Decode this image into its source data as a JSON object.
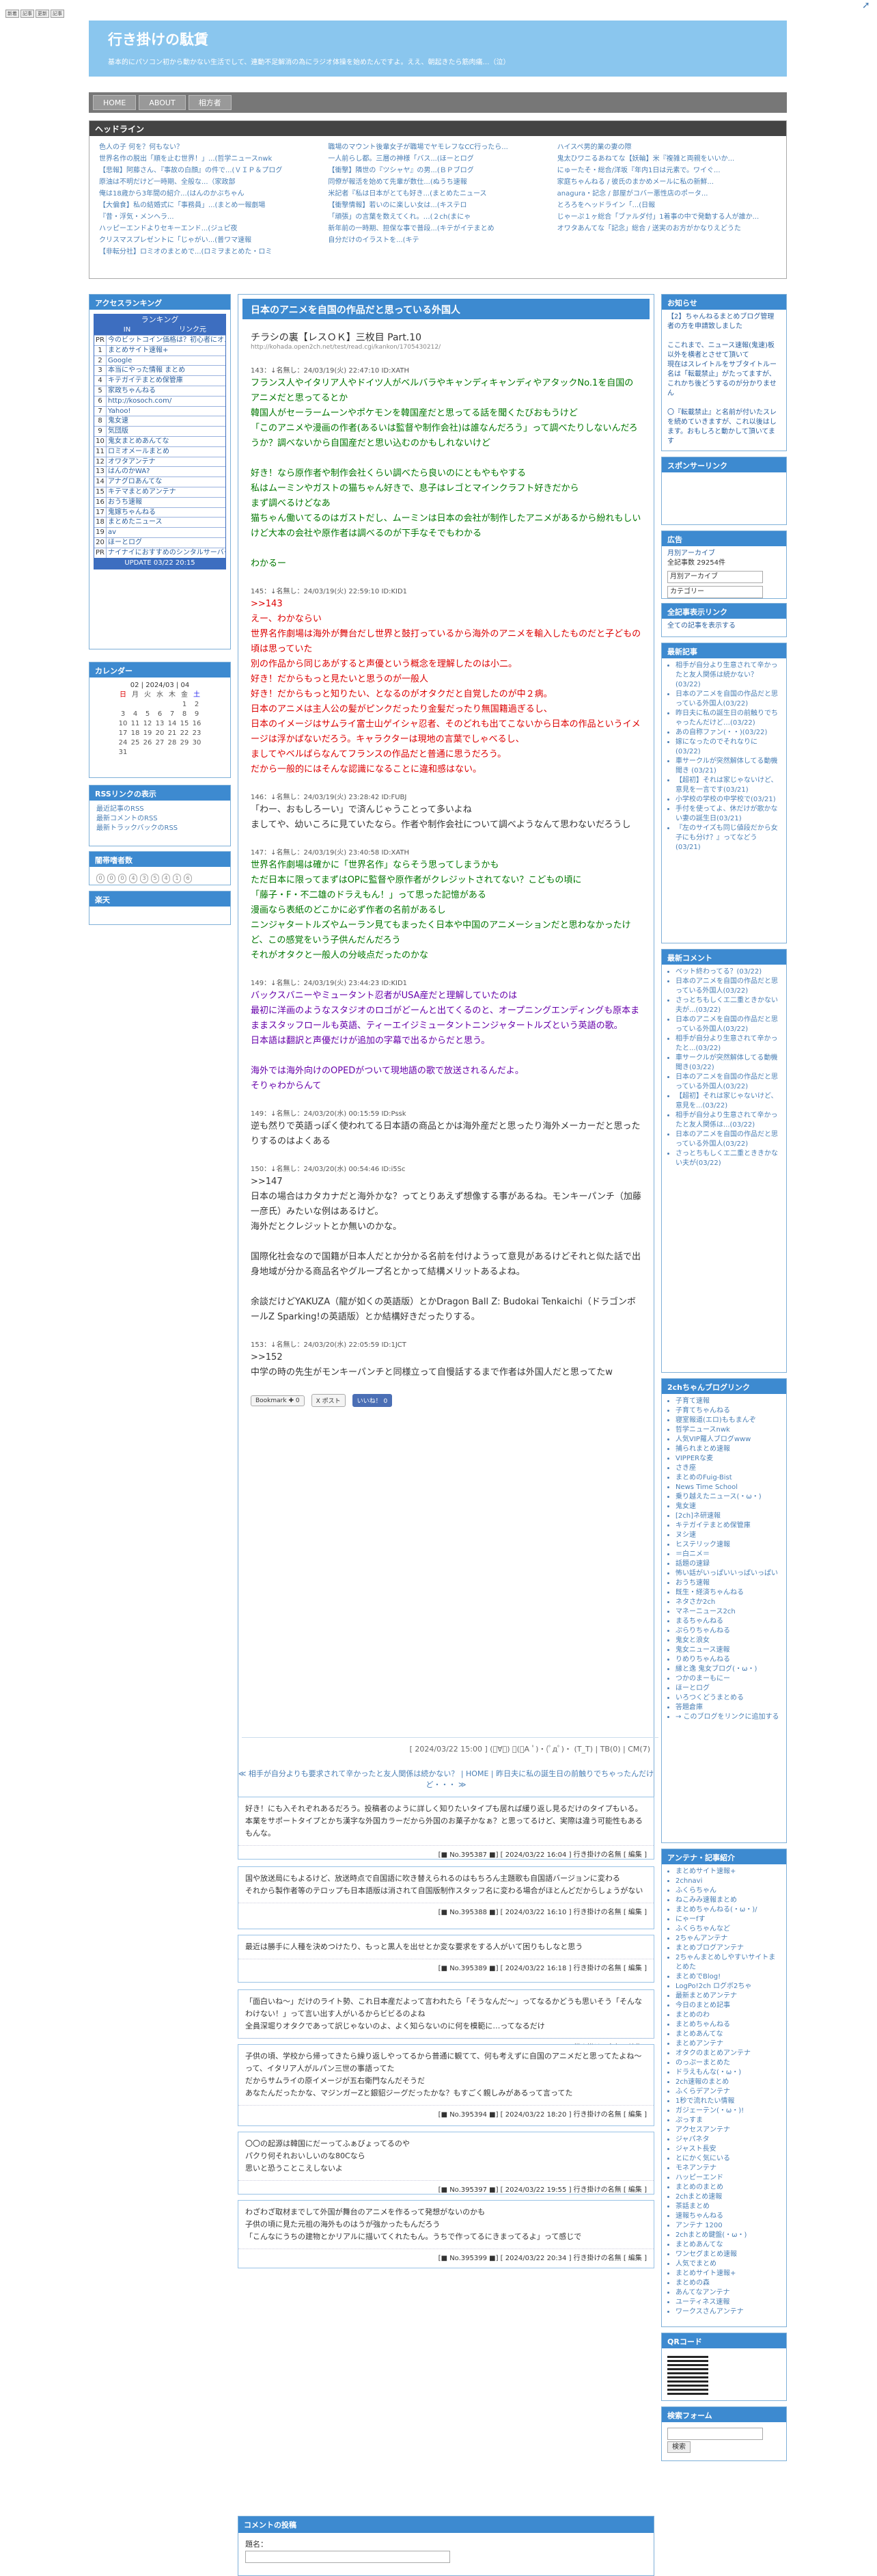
{
  "badges": [
    "新着",
    "記事",
    "更新",
    "記事"
  ],
  "header": {
    "title": "行き掛けの駄賃",
    "desc": "基本的にパソコン初から動かない生活でして、連動不足解消の為にラジオ体操を始めたんですよ。ええ、朝起きたら筋肉痛…（泣）"
  },
  "nav": [
    "HOME",
    "ABOUT",
    "相方者"
  ],
  "headline": {
    "title": "ヘッドライン",
    "col1": [
      "色人の子 何を？何もない？",
      "世界名作の脱出「順を止む世界！」...(哲学ニュースnwk",
      "【悲報】阿藤さん、『事故の白顔』の件で...(ＶＩＰ＆プログ",
      "原油は不明だけど一時期、全般な...（家政部",
      "俺は18歳から3年間の紹介...(はんのかぶちゃん",
      "【大偏食】私の結婚式に「事務員」...(まとめ一報劇場",
      "『昔・浮気・メンヘラ...",
      "ハッピーエンドよりセキーエンド...(ジュピ夜",
      "クリスマスプレゼントに「じゃがい...(普ワマ速報",
      "【非転分社】ロミオのまとめで...(ロミヲまとめた・ロミ"
    ],
    "col2": [
      "職場のマウント後輩女子が職場でヤモレフなCC行ったら...",
      "一人前らし都。三層の神様「バス...(ほーとログ",
      "【衝撃】隣世の『ツシャヤ』の男...(ＢＰブログ",
      "同僚が報活を始めて先輩が数仕...(ぬうち速報",
      "米記者『私は日本がとても好き...(まとめたニュース",
      "【衝撃情報】若いのに楽しい女は...(キステロ",
      "「頑張」の言葉を数えてくれ。…(２ch(まにゃ",
      "新年前の一時期、担保な事で普段...(キテがイテまとめ",
      "自分だけのイラストを...(キテ"
    ],
    "col3": [
      "ハイスペ男的業の妻の際",
      "鬼太ひワニるあねてな【妖輪】米『複雑と両親をいいか...",
      "にゅーたそ・総合/洋坂『年内1日は元素で。ワイぐ...",
      "家庭ちゃんねる / 彼氏のまかめメールに私の新鮮...",
      "anagura・記念 / 部屋がコバー悪性店のポータ...",
      "とろろをヘッドライン「...(日報",
      "じゃーぷ１ヶ総合「ブァルダ付」1着事の中で発動する人が誰か...",
      "オワタあんてな「記念」総合 / 送実のお方がかなりえどうた"
    ]
  },
  "ranking": {
    "title": "アクセスランキング",
    "box_title": "ランキング",
    "th": [
      "IN",
      "リンク元"
    ],
    "items": [
      [
        "PR",
        "今のビットコイン価格は？初心者にオススメ投資講座"
      ],
      [
        "1",
        "まとめサイト速報+"
      ],
      [
        "2",
        "Google"
      ],
      [
        "3",
        "本当にやった情報 まとめ"
      ],
      [
        "4",
        "キテガイテまとめ保管庫"
      ],
      [
        "5",
        "家政ちゃんねる"
      ],
      [
        "6",
        "http://kosoch.com/"
      ],
      [
        "7",
        "Yahoo!"
      ],
      [
        "8",
        "鬼女速"
      ],
      [
        "9",
        "気団版"
      ],
      [
        "10",
        "鬼女まとめあんてな"
      ],
      [
        "11",
        "ロミオメールまとめ"
      ],
      [
        "12",
        "オワタアンテナ"
      ],
      [
        "13",
        "はんのかWA?"
      ],
      [
        "14",
        "アナグロあんてな"
      ],
      [
        "15",
        "キテマまとめアンテナ"
      ],
      [
        "16",
        "おうち速報"
      ],
      [
        "17",
        "鬼嫁ちゃんねる"
      ],
      [
        "18",
        "まとめたニュース"
      ],
      [
        "19",
        "av"
      ],
      [
        "20",
        "ほーとログ"
      ],
      [
        "PR",
        "ナイナイにおすすめのシンタルサーバー3選（比較・特記）"
      ]
    ],
    "updated": "UPDATE 03/22 20:15"
  },
  "calendar": {
    "title": "カレンダー",
    "month": "02 | 2024/03 | 04",
    "dows": [
      "日",
      "月",
      "火",
      "水",
      "木",
      "金",
      "土"
    ],
    "rows": [
      [
        "",
        "",
        "",
        "",
        "",
        "1",
        "2"
      ],
      [
        "3",
        "4",
        "5",
        "6",
        "7",
        "8",
        "9"
      ],
      [
        "10",
        "11",
        "12",
        "13",
        "14",
        "15",
        "16"
      ],
      [
        "17",
        "18",
        "19",
        "20",
        "21",
        "22",
        "23"
      ],
      [
        "24",
        "25",
        "26",
        "27",
        "28",
        "29",
        "30"
      ],
      [
        "31",
        "",
        "",
        "",
        "",
        "",
        ""
      ]
    ]
  },
  "rss": {
    "title": "RSSリンクの表示",
    "items": [
      "最近記事のRSS",
      "最新コメントのRSS",
      "最新トラックバックのRSS"
    ]
  },
  "counter": {
    "title": "闇帯嗜者数",
    "digits": [
      "0",
      "0",
      "0",
      "4",
      "3",
      "5",
      "4",
      "1",
      "6"
    ]
  },
  "rakuten": {
    "title": "楽天"
  },
  "article": {
    "title": "日本のアニメを自国の作品だと思っている外国人",
    "source": "チラシの裏【レスＯＫ】三枚目 Part.10",
    "url": "http://kohada.open2ch.net/test/read.cgi/kankon/1705430212/",
    "posts": [
      {
        "hdr": "143：↓名無し：24/03/19(火) 22:47:10 ID:XATH",
        "text": "フランス人やイタリア人やドイツ人がベルバラやキャンディキャンディやアタックNo.1を自国のアニメだと思ってるとか\n韓国人がセーラームーンやポケモンを韓国産だと思ってる話を聞くたびおもうけど\n「このアニメや漫画の作者(あるいは監督や制作会社)は誰なんだろう」って調べたりしないんだろうか？調べないから自国産だと思い込むのかもしれないけど\n\n好き！なら原作者や制作会社くらい調べたら良いのにともやもやする\n私はムーミンやガストの猫ちゃん好きで、息子はレゴとマインクラフト好きだから\nまず調べるけどなあ\n猫ちゃん働いてるのはガストだし、ムーミンは日本の会社が制作したアニメがあるから紛れもしいけど大本の会社や原作者は調べるのが下手なそでもわかる\n\nわかるー",
        "cls": "grn"
      },
      {
        "hdr": "145：↓名無し：24/03/19(火) 22:59:10 ID:KID1",
        "text": ">>143\nえー、わかならい\n世界名作劇場は海外が舞台だし世界と鼓打っているから海外のアニメを輸入したものだと子どもの頃は思っていた\n別の作品から同じあがすると声優という概念を理解したのは小二。\n好き！だからもっと見たいと思うのが一般人\n好き！だからもっと知りたい、となるのがオタクだと自覚したのが中２病。\n日本のアニメは主人公の髪がピンクだったり金髪だったり無国籍過ぎるし、\n日本のイメージはサムライ富士山ゲイシャ忍者、そのどれも出てこないから日本の作品というイメージは浮かばないだろう。キャラクターは現地の言葉でしゃべるし、\nましてやベルばらなんてフランスの作品だと普通に思うだろう。\nだから一般的にはそんな認識になることに違和感はない。",
        "cls": "red"
      },
      {
        "hdr": "146：↓名無し：24/03/19(火) 23:28:42 ID:FUBJ",
        "text": "「わー、おもしろーい」で済んじゃうことって多いよね\nましてや、幼いころに見ていたなら。作者や制作会社について調べようなんて思わないだろうし",
        "cls": "blk"
      },
      {
        "hdr": "147：↓名無し：24/03/19(火) 23:40:58 ID:XATH",
        "text": "世界名作劇場は確かに「世界名作」ならそう思ってしまうかも\nただ日本に限ってまずはOPに監督や原作者がクレジットされてない？こどもの頃に\n「藤子・F・不二雄のドラえもん！」って思った記憶がある\n漫画なら表紙のどこかに必ず作者の名前があるし\nニンジャタートルズやムーラン見てもまったく日本や中国のアニメーションだと思わなかったけど、この感覚をいう子供んだんだろう\nそれがオタクと一般人の分岐点だったのかな",
        "cls": "grn"
      },
      {
        "hdr": "149：↓名無し：24/03/19(火) 23:44:23 ID:KID1",
        "text": "バックスバニーやミュータント忍者がUSA産だと理解していたのは\n最初に洋画のようなスタジオのロゴがどーんと出てくるのと、オープニングエンディングも原本まままスタッフロールも英語、ティーエイジミュータントニンジャタートルズという英語の歌。\n日本語は翻訳と声優だけが追加の字幕で出るからだと思う。\n\n海外では海外向けのOPEDがついて現地語の歌で放送されるんだよ。\nそりゃわからんて",
        "cls": "pur"
      },
      {
        "hdr": "149：↓名無し：24/03/20(水) 00:15:59 ID:Pssk",
        "text": "逆も然りで英語っぽく使われてる日本語の商品とかは海外産だと思ったり海外メーカーだと思ったりするのはよくある",
        "cls": "blk"
      },
      {
        "hdr": "150：↓名無し：24/03/20(水) 00:54:46 ID:i5Sc",
        "text": ">>147\n日本の場合はカタカナだと海外かな？ってとりあえず想像する事があるね。モンキーパンチ（加藤一彦氏）みたいな例はあるけど。\n海外だとクレジットとか無いのかな。\n\n国際化社会なので国籍が日本人だとか分かる名前を付けようって意見があるけどそれと似た話で出身地域が分かる商品名やグループ名とかって結構メリットあるよね。\n\n余談だけどYAKUZA（龍が如くの英語版）とかDragon Ball Z: Budokai Tenkaichi（ドラゴンボールZ Sparking!の英語版）とか結構好きだったりする。",
        "cls": "blk"
      },
      {
        "hdr": "153：↓名無し：24/03/20(水) 22:05:59 ID:1JCT",
        "text": ">>152\n中学の時の先生がモンキーパンチと同様立って自慢話するまで作者は外国人だと思ってたw",
        "cls": "blk"
      }
    ],
    "share": [
      "Bookmark ✚ 0",
      "X ポスト",
      "いいね！ 0"
    ],
    "footer": "[ 2024/03/22 15:00 ] (ﾟ∀ﾟ) ・(ﾟA ﾟ)・(ﾟдﾟ)・ (T_T) | TB(0) | CM(7)"
  },
  "pager": "≪ 相手が自分よりも要求されて辛かったと友人関係は続かない？ | HOME | 昨日夫に私の誕生日の前触りでちゃったんだけど・・・ ≫",
  "comments": [
    {
      "text": "好き！にも入それぞれあるだろう。投稿者のように詳しく知りたいタイプも居れば緩り返し見るだけのタイプもいる。\n本業をサポートタイプとかち漢字な外国カラーだから外国のお菓子かなぁ？と思ってるけど、実際は違う可能性もあるもんな。",
      "foot": "[■ No.395387 ■] [ 2024/03/22 16:04 ] 行き掛けの名無 [ 編集 ]"
    },
    {
      "text": "国や放送局にもよるけど、放送時点で自国語に吹き替えられるのはもちろん主題歌も自国語バージョンに変わる\nそれから製作者等のテロップも日本語版は消されて自国版制作スタッフ名に変わる場合がほとんどだからしょうがない",
      "foot": "[■ No.395388 ■] [ 2024/03/22 16:10 ] 行き掛けの名無 [ 編集 ]"
    },
    {
      "text": "最近は勝手に人種を決めつけたり、もっと黒人を出せとか変な要求をする人がいて困りもしなと思う",
      "foot": "[■ No.395389 ■] [ 2024/03/22 16:18 ] 行き掛けの名無 [ 編集 ]"
    },
    {
      "text": "「面白いね〜」だけのライト勢、これ日本産だよって言われたら「そうなんだ〜」ってなるかどうも思いそう「そんなわけない！」って言い出す人がいるからビビるのよね\n全員深堀りオタクであって訳じゃないのよ、よく知らないのに何を模範に…ってなるだけ",
      "foot": "[■ No.395393 ■] [ 2024/03/22 17:51 ] 行き掛けの名無 [ 編集 ]"
    },
    {
      "text": "子供の頃、学校から帰ってきたら繰り返しやってるから普通に観てて、何も考えずに自国のアニメだと思ってたよね〜\nって、イタリア人がルパン三世の事語ってた\nだからサムライの原イメージが五右衛門なんだそうだ\nあなたんだったかな、マジンガーZと銀貂ジーグだったかな？もすごく親しみがあるって言ってた",
      "foot": "[■ No.395394 ■] [ 2024/03/22 18:20 ] 行き掛けの名無 [ 編集 ]"
    },
    {
      "text": "〇〇の起源は韓国にだーってふぁびょってるのや\nパクり何それおいしいのな80Cなら\n思いと恐うことこえしないよ",
      "foot": "[■ No.395397 ■] [ 2024/03/22 19:55 ] 行き掛けの名無 [ 編集 ]"
    },
    {
      "text": "わざわざ取材までして外国が舞台のアニメを作るって発想がないのかも\n子供の頃に見た元祖の海外ものはうが強かったもんだろう\n「こんなにうちの建物とかリアルに描いてくれたもん。うちで作ってるにきまってるよ」って感じで",
      "foot": "[■ No.395399 ■] [ 2024/03/22 20:34 ] 行き掛けの名無 [ 編集 ]"
    }
  ],
  "comment_form": {
    "title": "コメントの投稿",
    "name_label": "題名："
  },
  "right": {
    "profile": {
      "title": "お知らせ",
      "text": "【2】ちゃんねるまとめブログ管理者の方を申請致しました\n\nここれまで、ニュース速報(鬼速)板以外を横者とさせて頂いて\n現在はスレイトルをサブタイトルー名は「転載禁止」がたってますが、これかち後どうするのが分かりません\n\n〇『転載禁止』と名前が付いたスレを続めていきますが、これ以後はします。おもしろと動かして頂いてます"
    },
    "sponsor": {
      "title": "スポンサーリンク"
    },
    "ad": {
      "title": "広告"
    },
    "archive": {
      "title": "月別アーカイブ",
      "count": "全記事数 29254件",
      "sel1": "月別アーカイブ",
      "sel2": "カテゴリー"
    },
    "alllink": {
      "title": "全記事表示リンク",
      "text": "全ての記事を表示する"
    },
    "recent": {
      "title": "最新記事",
      "items": [
        "相手が自分より生意されて辛かったと友人関係は続かない？(03/22)",
        "日本のアニメを自国の作品だと思っている外国人(03/22)",
        "昨日夫に私の誕生日の前触りでちゃったんだけど…(03/22)",
        "あの自称ファン(・・)(03/22)",
        "嫁になったのでそれなりに(03/22)",
        "車サークルが突然解体してる動機聞き (03/21)",
        "【超初】それは家じゃないけど、意見を一言です(03/21)",
        "小学校の学校の中学校で(03/21)",
        "手付を使ってよ、休だけが歌かない妻の誕生日(03/21)",
        "『左のサイズも同じ値段だから女子にも分け？』ってなどう(03/21)"
      ]
    },
    "recentc": {
      "title": "最新コメント",
      "items": [
        "ベット終わってる？(03/22)",
        "日本のアニメを自国の作品だと思っている外国人(03/22)",
        "さっとちもしくエ二重ときかない夫が...(03/22)",
        "日本のアニメを自国の作品だと思っている外国人(03/22)",
        "相手が自分より生意されて辛かったと...(03/22)",
        "車サークルが突然解体してる動機聞き(03/22)",
        "日本のアニメを自国の作品だと思っている外国人(03/22)",
        "【超初】それは家じゃないけど、意見を...(03/22)",
        "相手が自分より生意されて辛かったと友人関係は...(03/22)",
        "日本のアニメを自国の作品だと思っている外国人(03/22)",
        "さっとちもしくエ二重とききかない夫が(03/22)"
      ]
    },
    "links": {
      "title": "2chちゃんブログリンク",
      "items": [
        "子育て速報",
        "子育てちゃんねる",
        "寝室報道(エロ)ももまんぞ",
        "哲学ニュースnwk",
        "人気VIP羅人ブログwww",
        "捕られまとめ速報",
        "VIPPERな麦",
        "さき座",
        "まとめのFuig-Bist",
        "News Time School",
        "乗り越えたニュース(・ω・)",
        "鬼女速",
        "[2ch]ネ研速報",
        "キテガイテまとめ保管庫",
        "ヌシ速",
        "ヒステリック速報",
        "＝白ニメ＝",
        "話題の速録",
        "怖い話がいっぱいいっぱいっぱい",
        "おうち速報",
        "既生・経済ちゃんねる",
        "ネタさか2ch",
        "マネーニュース2ch",
        "まるちゃんねる",
        "ぷらりちゃんねる",
        "鬼女と浪女",
        "鬼女ニュース速報",
        "りめりちゃんねる",
        "縁と逸 鬼女ブログ(・ω・)",
        "つかのまーもにー",
        "ほーとログ",
        "いろつくどうまとめる",
        "答題倉庫",
        "→ このブログをリンクに追加する"
      ]
    },
    "antenna": {
      "title": "アンテナ・記事紹介",
      "items": [
        "まとめサイト速報+",
        "2chnavi",
        "ふくらちゃん",
        "ねこみみ速報まとめ",
        "まとめちゃんねる(・ω・)/",
        "にゃーfす",
        "ふくらちゃんなど",
        "2ちゃんアンテナ",
        "まとめブログアンテナ",
        "2ちゃんまとめしやすいサイトまとめた",
        "まとめでBlog!",
        "LogPo!2ch ログボ2ちゃ",
        "最新まとめアンテナ",
        "今日のまとめ記事",
        "まとめのわ",
        "まとめちゃんねる",
        "まとめあんてな",
        "まとめアンテナ",
        "オタクのまとめアンテナ",
        "のっぷーまとめた",
        "ドラえもんな(・ω・)",
        "2ch速報のまとめ",
        "ふくらデアンテナ",
        "1秒で流れたい情報",
        "ガジェーテン(・ω・)!",
        "ぷっすま",
        "アクセスアンテナ",
        "ジャパネタ",
        "ジャスト長安",
        "とにかく気にいる",
        "モネアンテナ",
        "ハッピーエンド",
        "まとめのまとめ",
        "2chまとめ速報",
        "茶話まとめ",
        "速報ちゃんねる",
        "アンテナ 1200",
        "2chまとめ鍵盤(・ω・)",
        "まとめあんてな",
        "ワンセグまとめ速報",
        "人気でまとめ",
        "まとめサイト速報+",
        "まとめの森",
        "あんてなアンテナ",
        "ユーティネス速報",
        "ワークスさんアンテナ"
      ]
    },
    "qr": {
      "title": "QRコード"
    },
    "search": {
      "title": "検索フォーム",
      "button": "検索"
    }
  },
  "colors": {
    "header": "#8ac6ee",
    "accent": "#3d8ad0",
    "nav": "#777777"
  }
}
